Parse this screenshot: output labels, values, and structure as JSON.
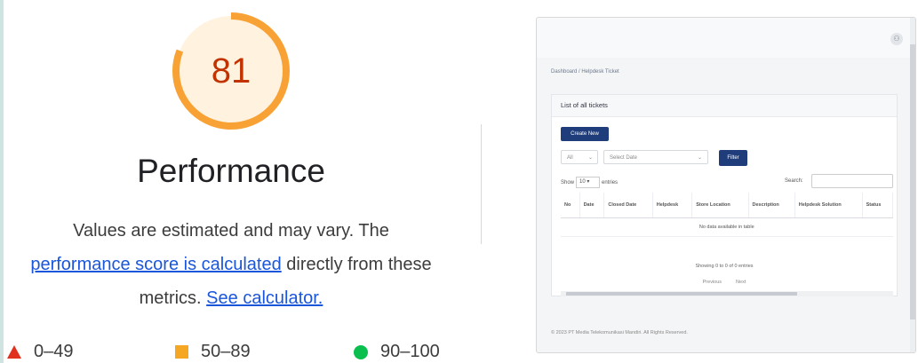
{
  "score": 81,
  "score_fraction": 0.81,
  "title": "Performance",
  "description": {
    "line1": "Values are estimated and may vary. The",
    "link_score": "performance score is calculated",
    "mid": " directly from these",
    "metrics": "metrics. ",
    "link_calc": "See calculator."
  },
  "legend": {
    "fail": "0–49",
    "average": "50–89",
    "pass": "90–100"
  },
  "colors": {
    "gauge_arc": "#f8a236",
    "gauge_bg": "#fff3e0",
    "score_text": "#c33300",
    "link": "#1a56db"
  },
  "screenshot": {
    "breadcrumb": "Dashboard / Helpdesk Ticket",
    "card_title": "List of all tickets",
    "create_button": "Create New",
    "filter_select_value": "All",
    "date_select_placeholder": "Select Date",
    "filter_button": "Filter",
    "show_label": "Show",
    "show_value": "10",
    "entries_label": "entries",
    "search_label": "Search:",
    "columns": [
      "No",
      "Date",
      "Closed Date",
      "Helpdesk",
      "Store Location",
      "Description",
      "Helpdesk Solution",
      "Status"
    ],
    "empty_text": "No data available in table",
    "info_text": "Showing 0 to 0 of 0 entries",
    "pager_prev": "Previous",
    "pager_next": "Next",
    "footer": "© 2023 PT Media Telekomunikasi Mandiri. All Rights Reserved."
  }
}
